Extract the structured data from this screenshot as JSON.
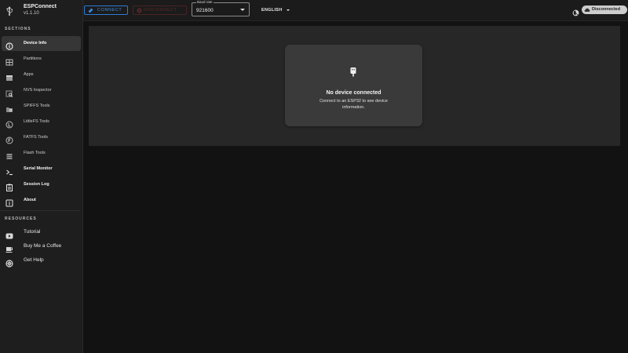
{
  "app": {
    "title": "ESPConnect",
    "version": "v1.1.10"
  },
  "sidebar": {
    "sections_heading": "SECTIONS",
    "items": [
      {
        "label": "Device Info",
        "icon": "info-circle-icon",
        "active": true
      },
      {
        "label": "Partitions",
        "icon": "table-grid-icon"
      },
      {
        "label": "Apps",
        "icon": "apps-window-icon"
      },
      {
        "label": "NVS Inspector",
        "icon": "nvs-search-icon"
      },
      {
        "label": "SPIFFS Tools",
        "icon": "folder-search-icon"
      },
      {
        "label": "LittleFS Tools",
        "icon": "littlefs-circle-icon"
      },
      {
        "label": "FATFS Tools",
        "icon": "fatfs-circle-icon"
      },
      {
        "label": "Flash Tools",
        "icon": "memory-stack-icon"
      },
      {
        "label": "Serial Monitor",
        "icon": "terminal-icon",
        "bold": true
      },
      {
        "label": "Session Log",
        "icon": "clipboard-icon",
        "bold": true
      },
      {
        "label": "About",
        "icon": "about-info-icon",
        "bold": true
      }
    ],
    "resources_heading": "RESOURCES",
    "resources": [
      {
        "label": "Tutorial",
        "icon": "youtube-icon"
      },
      {
        "label": "Buy Me a Coffee",
        "icon": "coffee-icon"
      },
      {
        "label": "Get Help",
        "icon": "lifebuoy-icon"
      }
    ]
  },
  "topbar": {
    "connect_label": "CONNECT",
    "disconnect_label": "DISCONNECT",
    "baud": {
      "label": "Baud rate",
      "value": "921600"
    },
    "language": "ENGLISH",
    "status": "Disconnected"
  },
  "main": {
    "empty_title": "No device connected",
    "empty_text": "Connect to an ESP32 to see device information."
  },
  "colors": {
    "accent": "#2e7bd6",
    "sidebar_bg": "#1e1e1e",
    "main_bg": "#121212",
    "panel_bg": "#272727",
    "card_bg": "#3a3a3a"
  }
}
